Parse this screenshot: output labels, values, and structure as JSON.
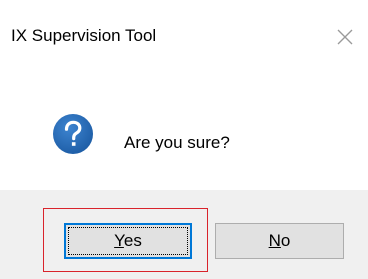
{
  "window": {
    "title": "IX Supervision Tool",
    "close_icon": "close-icon"
  },
  "message": {
    "text": "Are you sure?",
    "icon": "question-icon",
    "icon_color": "#1f5fa8"
  },
  "buttons": {
    "yes": {
      "mnemonic": "Y",
      "rest": "es"
    },
    "no": {
      "mnemonic": "N",
      "rest": "o"
    }
  },
  "colors": {
    "footer_background": "#f0f0f0",
    "focus_border": "#0078d7",
    "highlight_border": "#d9232b"
  }
}
